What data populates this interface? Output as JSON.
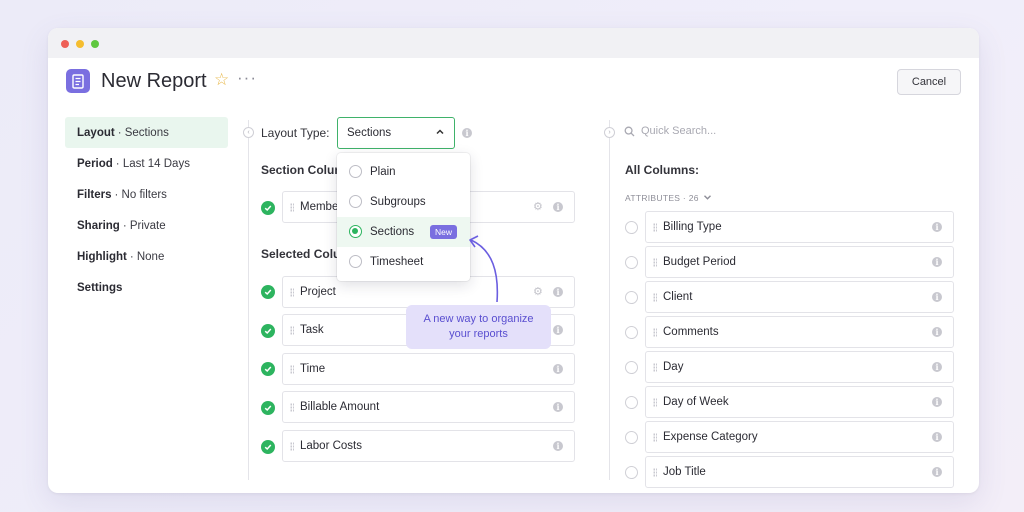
{
  "window": {
    "title": "New Report",
    "cancel_label": "Cancel"
  },
  "sidebar": {
    "items": [
      {
        "key": "Layout",
        "value": "Sections",
        "active": true
      },
      {
        "key": "Period",
        "value": "Last 14 Days"
      },
      {
        "key": "Filters",
        "value": "No filters"
      },
      {
        "key": "Sharing",
        "value": "Private"
      },
      {
        "key": "Highlight",
        "value": "None"
      },
      {
        "key": "Settings",
        "value": ""
      }
    ]
  },
  "layout": {
    "label": "Layout Type:",
    "selected": "Sections",
    "options": [
      {
        "label": "Plain",
        "checked": false
      },
      {
        "label": "Subgroups",
        "checked": false
      },
      {
        "label": "Sections",
        "checked": true,
        "badge": "New"
      },
      {
        "label": "Timesheet",
        "checked": false
      }
    ],
    "tooltip": "A new way to organize your reports"
  },
  "section_columns": {
    "label": "Section Colum",
    "items": [
      "Membe"
    ]
  },
  "selected_columns": {
    "label": "Selected Colu",
    "items": [
      "Project",
      "Task",
      "Time",
      "Billable Amount",
      "Labor Costs"
    ]
  },
  "all_columns": {
    "search_placeholder": "Quick Search...",
    "label": "All Columns:",
    "group": "ATTRIBUTES · 26",
    "items": [
      "Billing Type",
      "Budget Period",
      "Client",
      "Comments",
      "Day",
      "Day of Week",
      "Expense Category",
      "Job Title"
    ]
  },
  "colors": {
    "accent": "#7a6fe0",
    "check": "#2db45f",
    "active_bg": "#e9f6ee"
  }
}
